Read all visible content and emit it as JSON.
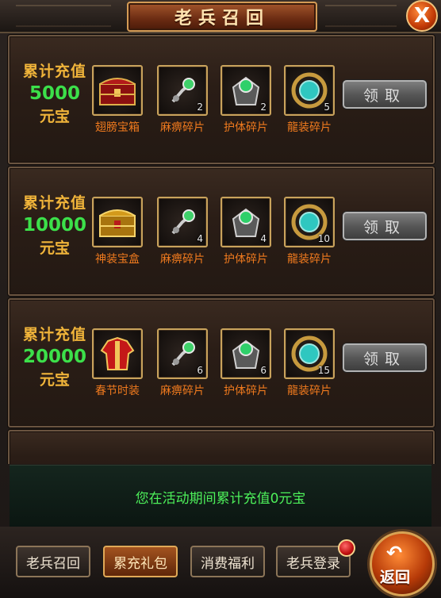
{
  "window": {
    "title": "老兵召回",
    "close_label": "X"
  },
  "tiers": [
    {
      "line1": "累计充值",
      "amount": "5000",
      "unit": "元宝",
      "items": [
        {
          "name": "翅膀宝箱",
          "icon": "red-treasure-chest-icon",
          "count": ""
        },
        {
          "name": "麻痹碎片",
          "icon": "paralysis-ring-shard-icon",
          "count": "2"
        },
        {
          "name": "护体碎片",
          "icon": "protection-shard-icon",
          "count": "2"
        },
        {
          "name": "龍装碎片",
          "icon": "dragon-orb-shard-icon",
          "count": "5"
        }
      ],
      "claim_label": "领取"
    },
    {
      "line1": "累计充值",
      "amount": "10000",
      "unit": "元宝",
      "items": [
        {
          "name": "神装宝盒",
          "icon": "gold-treasure-chest-icon",
          "count": ""
        },
        {
          "name": "麻痹碎片",
          "icon": "paralysis-ring-shard-icon",
          "count": "4"
        },
        {
          "name": "护体碎片",
          "icon": "protection-shard-icon",
          "count": "4"
        },
        {
          "name": "龍装碎片",
          "icon": "dragon-orb-shard-icon",
          "count": "10"
        }
      ],
      "claim_label": "领取"
    },
    {
      "line1": "累计充值",
      "amount": "20000",
      "unit": "元宝",
      "items": [
        {
          "name": "春节时装",
          "icon": "festival-costume-icon",
          "count": ""
        },
        {
          "name": "麻痹碎片",
          "icon": "paralysis-ring-shard-icon",
          "count": "6"
        },
        {
          "name": "护体碎片",
          "icon": "protection-shard-icon",
          "count": "6"
        },
        {
          "name": "龍装碎片",
          "icon": "dragon-orb-shard-icon",
          "count": "15"
        }
      ],
      "claim_label": "领取"
    }
  ],
  "status_text": "您在活动期间累计充值0元宝",
  "tabs": [
    {
      "label": "老兵召回",
      "active": false
    },
    {
      "label": "累充礼包",
      "active": true
    },
    {
      "label": "消费福利",
      "active": false
    },
    {
      "label": "老兵登录",
      "active": false,
      "badge": true
    }
  ],
  "back_button": {
    "label": "返回",
    "icon": "back-arrow-icon"
  },
  "colors": {
    "requirement": "#f0b43a",
    "amount": "#3ce04a",
    "item_name": "#f07a1e",
    "status": "#4df05a"
  }
}
